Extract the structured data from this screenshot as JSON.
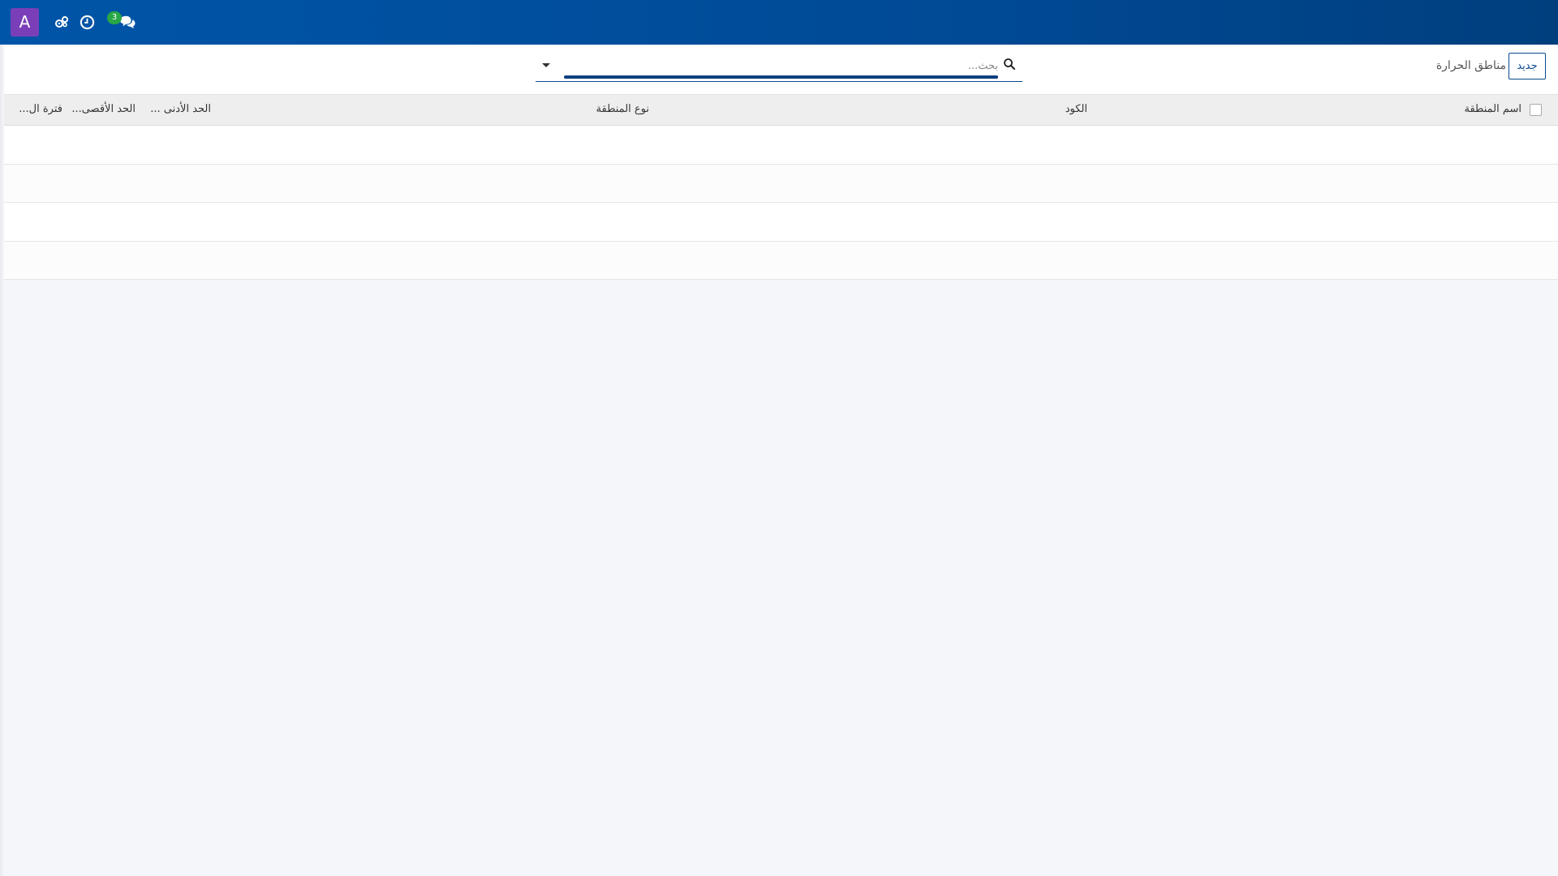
{
  "topbar": {
    "avatar_letter": "A",
    "messages_count": "3",
    "icons": [
      "avatar",
      "settings-cogs-icon",
      "clock-icon",
      "chat-icon"
    ],
    "colors": {
      "bar": "#0055a8",
      "avatar": "#7a3fb8",
      "badge": "#28a745"
    }
  },
  "control_panel": {
    "new_label": "جديد",
    "breadcrumb": "مناطق الحرارة",
    "search_placeholder": "بحث..."
  },
  "table": {
    "columns": {
      "zone_name": "اسم المنطقة",
      "code": "الكود",
      "zone_type": "نوع المنطقة",
      "min_limit": "الحد الأدنى ...",
      "max_limit": "الحد الأقصى...",
      "period": "فترة ال..."
    },
    "rows": [
      [],
      [],
      [],
      []
    ]
  }
}
